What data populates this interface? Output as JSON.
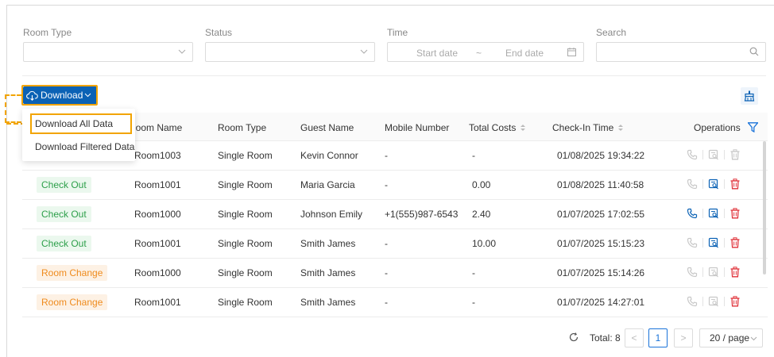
{
  "filters": {
    "room_type_label": "Room Type",
    "status_label": "Status",
    "time_label": "Time",
    "search_label": "Search",
    "start_date_placeholder": "Start date",
    "date_separator": "~",
    "end_date_placeholder": "End date"
  },
  "toolbar": {
    "download_label": "Download"
  },
  "download_menu": {
    "items": [
      {
        "label": "Download All Data"
      },
      {
        "label": "Download Filtered Data"
      }
    ]
  },
  "table": {
    "columns": {
      "status": "",
      "room_name": "Room Name",
      "room_type": "Room Type",
      "guest_name": "Guest Name",
      "mobile_number": "Mobile Number",
      "total_costs": "Total Costs",
      "check_in_time": "Check-In Time",
      "operations": "Operations"
    },
    "rows": [
      {
        "status": "",
        "room_name": "Room1003",
        "room_type": "Single Room",
        "guest_name": "Kevin Connor",
        "mobile": "-",
        "total": "-",
        "check_in": "01/08/2025 19:34:22",
        "call_active": false,
        "view_active": false,
        "delete_active": false
      },
      {
        "status": "Check Out",
        "status_color": "green",
        "room_name": "Room1001",
        "room_type": "Single Room",
        "guest_name": "Maria Garcia",
        "mobile": "-",
        "total": "0.00",
        "check_in": "01/08/2025 11:40:58",
        "call_active": false,
        "view_active": true,
        "delete_active": true
      },
      {
        "status": "Check Out",
        "status_color": "green",
        "room_name": "Room1000",
        "room_type": "Single Room",
        "guest_name": "Johnson Emily",
        "mobile": "+1(555)987-6543",
        "total": "2.40",
        "check_in": "01/07/2025 17:02:55",
        "call_active": true,
        "view_active": true,
        "delete_active": true
      },
      {
        "status": "Check Out",
        "status_color": "green",
        "room_name": "Room1001",
        "room_type": "Single Room",
        "guest_name": "Smith James",
        "mobile": "-",
        "total": "10.00",
        "check_in": "01/07/2025 15:15:23",
        "call_active": false,
        "view_active": true,
        "delete_active": true
      },
      {
        "status": "Room Change",
        "status_color": "orange",
        "room_name": "Room1000",
        "room_type": "Single Room",
        "guest_name": "Smith James",
        "mobile": "-",
        "total": "-",
        "check_in": "01/07/2025 15:14:26",
        "call_active": false,
        "view_active": false,
        "delete_active": true
      },
      {
        "status": "Room Change",
        "status_color": "orange",
        "room_name": "Room1001",
        "room_type": "Single Room",
        "guest_name": "Smith James",
        "mobile": "-",
        "total": "-",
        "check_in": "01/07/2025 14:27:01",
        "call_active": false,
        "view_active": false,
        "delete_active": true
      }
    ]
  },
  "pagination": {
    "total_text": "Total: 8",
    "current_page": "1",
    "prev": "<",
    "next": ">",
    "page_size": "20 / page"
  },
  "colors": {
    "primary": "#0b62b5",
    "highlight": "#f2a400",
    "danger": "#e0323a",
    "success": "#2d9f4a",
    "warning": "#ef8b1d",
    "disabled_icon": "#c8c8c8"
  }
}
